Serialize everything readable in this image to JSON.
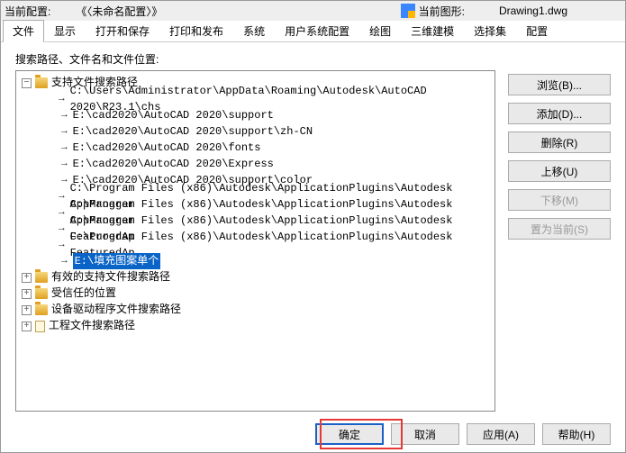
{
  "header": {
    "config_label": "当前配置:",
    "config_value": "《〈未命名配置〉》",
    "drawing_label": "当前图形:",
    "drawing_value": "Drawing1.dwg"
  },
  "tabs": [
    "文件",
    "显示",
    "打开和保存",
    "打印和发布",
    "系统",
    "用户系统配置",
    "绘图",
    "三维建模",
    "选择集",
    "配置"
  ],
  "active_tab": 0,
  "section_label": "搜索路径、文件名和文件位置:",
  "tree": {
    "root": {
      "label": "支持文件搜索路径",
      "expanded": true,
      "paths": [
        "C:\\Users\\Administrator\\AppData\\Roaming\\Autodesk\\AutoCAD 2020\\R23.1\\chs",
        "E:\\cad2020\\AutoCAD 2020\\support",
        "E:\\cad2020\\AutoCAD 2020\\support\\zh-CN",
        "E:\\cad2020\\AutoCAD 2020\\fonts",
        "E:\\cad2020\\AutoCAD 2020\\Express",
        "E:\\cad2020\\AutoCAD 2020\\support\\color",
        "C:\\Program Files (x86)\\Autodesk\\ApplicationPlugins\\Autodesk AppManager",
        "C:\\Program Files (x86)\\Autodesk\\ApplicationPlugins\\Autodesk AppManager",
        "C:\\Program Files (x86)\\Autodesk\\ApplicationPlugins\\Autodesk FeaturedAp",
        "C:\\Program Files (x86)\\Autodesk\\ApplicationPlugins\\Autodesk FeaturedAp",
        "E:\\填充图案单个"
      ],
      "selected_index": 10
    },
    "siblings": [
      "有效的支持文件搜索路径",
      "受信任的位置",
      "设备驱动程序文件搜索路径",
      "工程文件搜索路径"
    ]
  },
  "side_buttons": {
    "browse": "浏览(B)...",
    "add": "添加(D)...",
    "remove": "删除(R)",
    "up": "上移(U)",
    "down": "下移(M)",
    "set_current": "置为当前(S)"
  },
  "footer": {
    "ok": "确定",
    "cancel": "取消",
    "apply": "应用(A)",
    "help": "帮助(H)"
  }
}
